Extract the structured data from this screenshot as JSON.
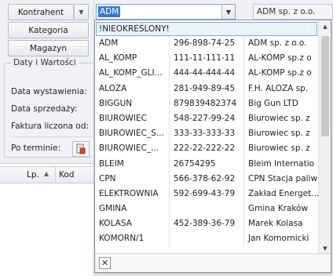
{
  "left_panel": {
    "kontrahent_label": "Kontrahent",
    "kategoria_label": "Kategoria",
    "magazyn_label": "Magazyn",
    "group_title": "Daty i Wartości",
    "data_wystawienia": "Data wystawienia:",
    "data_sprzedazy": "Data sprzedaży:",
    "faktura_liczona_od": "Faktura liczona od:",
    "po_terminie": "Po terminie:",
    "grid_lp": "Lp.",
    "grid_kod": "Kod"
  },
  "combo": {
    "value": "ADM",
    "right_value": "ADM sp. z o.o."
  },
  "dropdown": {
    "rows": [
      {
        "code": "!NIEOKREŚLONY!",
        "nip": "",
        "name": "",
        "selected": true
      },
      {
        "code": "ADM",
        "nip": "296-898-74-25",
        "name": "ADM sp. z o.o."
      },
      {
        "code": "AL_KOMP",
        "nip": "111-11-111-11",
        "name": "AL-KOMP sp.z o"
      },
      {
        "code": "AL_KOMP_GLI...",
        "nip": "444-44-444-44",
        "name": "AL-KOMP sp.z o"
      },
      {
        "code": "ALOZA",
        "nip": "281-949-89-45",
        "name": "F.H. ALOZA sp."
      },
      {
        "code": "BIGGUN",
        "nip": "879839482374",
        "name": "Big Gun LTD"
      },
      {
        "code": "BIUROWIEC",
        "nip": "548-227-99-24",
        "name": "Biurowiec sp. z"
      },
      {
        "code": "BIUROWIEC_S...",
        "nip": "333-33-333-33",
        "name": "Biurowiec sp. z"
      },
      {
        "code": "BIUROWIEC_...",
        "nip": "222-22-222-22",
        "name": "Biurowiec sp. z"
      },
      {
        "code": "BLEIM",
        "nip": "26754295",
        "name": "Bleim Internatio"
      },
      {
        "code": "CPN",
        "nip": "566-378-62-92",
        "name": "CPN Stacja paliw"
      },
      {
        "code": "ELEKTROWNIA",
        "nip": "592-699-43-79",
        "name": "Zakład Energet..."
      },
      {
        "code": "GMINA",
        "nip": "",
        "name": "Gmina Kraków"
      },
      {
        "code": "KOLASA",
        "nip": "452-389-36-79",
        "name": "Marek Kolasa"
      },
      {
        "code": "KOMORN/1",
        "nip": "",
        "name": "Jan Komornicki"
      }
    ],
    "close_symbol": "✕"
  },
  "icons": {
    "combo_arrow": "▼",
    "dd_arrow": "▼",
    "scroll_up": "▲",
    "scroll_down": "▼",
    "sort_up": "▲"
  },
  "colors": {
    "selection_fill": "#3a78c9",
    "selected_row_border": "#7ea8d8"
  }
}
